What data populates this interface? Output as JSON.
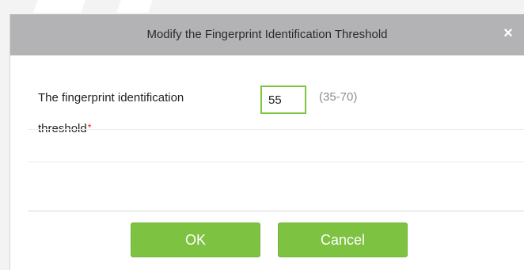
{
  "dialog": {
    "title": "Modify the Fingerprint Identification Threshold",
    "close_glyph": "×",
    "close_icon": "close-icon"
  },
  "form": {
    "label_line1": "The fingerprint identification",
    "label_line2": "threshold",
    "required_mark": "*",
    "threshold_value": "55",
    "range_hint": "(35-70)"
  },
  "buttons": {
    "ok_label": "OK",
    "cancel_label": "Cancel"
  },
  "colors": {
    "titlebar": "#b3b3b6",
    "button_green": "#7ec242",
    "input_border": "#7cc53e",
    "required": "#e02020"
  }
}
